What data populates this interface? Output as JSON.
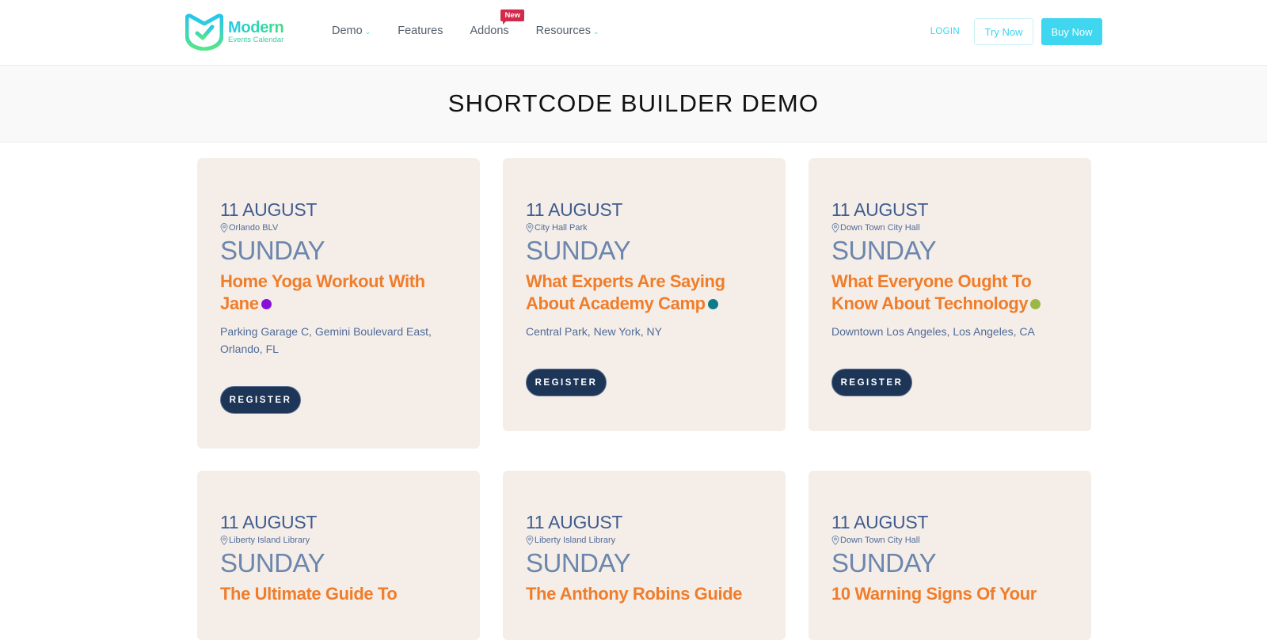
{
  "header": {
    "logo_title": "Modern",
    "logo_subtitle": "Events Calendar",
    "nav": [
      {
        "label": "Demo",
        "has_dropdown": true
      },
      {
        "label": "Features",
        "has_dropdown": false
      },
      {
        "label": "Addons",
        "has_dropdown": false,
        "badge": "New"
      },
      {
        "label": "Resources",
        "has_dropdown": true
      }
    ],
    "login_label": "LOGIN",
    "try_label": "Try Now",
    "buy_label": "Buy Now"
  },
  "page_title": "SHORTCODE BUILDER DEMO",
  "colors": {
    "accent": "#3fd6ef",
    "title_orange": "#ef7d2b",
    "register_bg": "#1d3557",
    "card_bg": "#f5eee8"
  },
  "events": [
    {
      "date": "11 AUGUST",
      "location": "Orlando BLV",
      "day": "SUNDAY",
      "title": "Home Yoga Workout With Jane",
      "dot_color": "#8a0fd9",
      "address": "Parking Garage C, Gemini Boulevard East, Orlando, FL",
      "button": "REGISTER"
    },
    {
      "date": "11 AUGUST",
      "location": "City Hall Park",
      "day": "SUNDAY",
      "title": "What Experts Are Saying About Academy Camp",
      "dot_color": "#0f7a8a",
      "address": "Central Park, New York, NY",
      "button": "REGISTER"
    },
    {
      "date": "11 AUGUST",
      "location": "Down Town City Hall",
      "day": "SUNDAY",
      "title": "What Everyone Ought To Know About Technology",
      "dot_color": "#9bb846",
      "address": "Downtown Los Angeles, Los Angeles, CA",
      "button": "REGISTER"
    },
    {
      "date": "11 AUGUST",
      "location": "Liberty Island Library",
      "day": "SUNDAY",
      "title": "The Ultimate Guide To",
      "dot_color": "",
      "address": "",
      "button": ""
    },
    {
      "date": "11 AUGUST",
      "location": "Liberty Island Library",
      "day": "SUNDAY",
      "title": "The Anthony Robins Guide",
      "dot_color": "",
      "address": "",
      "button": ""
    },
    {
      "date": "11 AUGUST",
      "location": "Down Town City Hall",
      "day": "SUNDAY",
      "title": "10 Warning Signs Of Your",
      "dot_color": "",
      "address": "",
      "button": ""
    }
  ]
}
